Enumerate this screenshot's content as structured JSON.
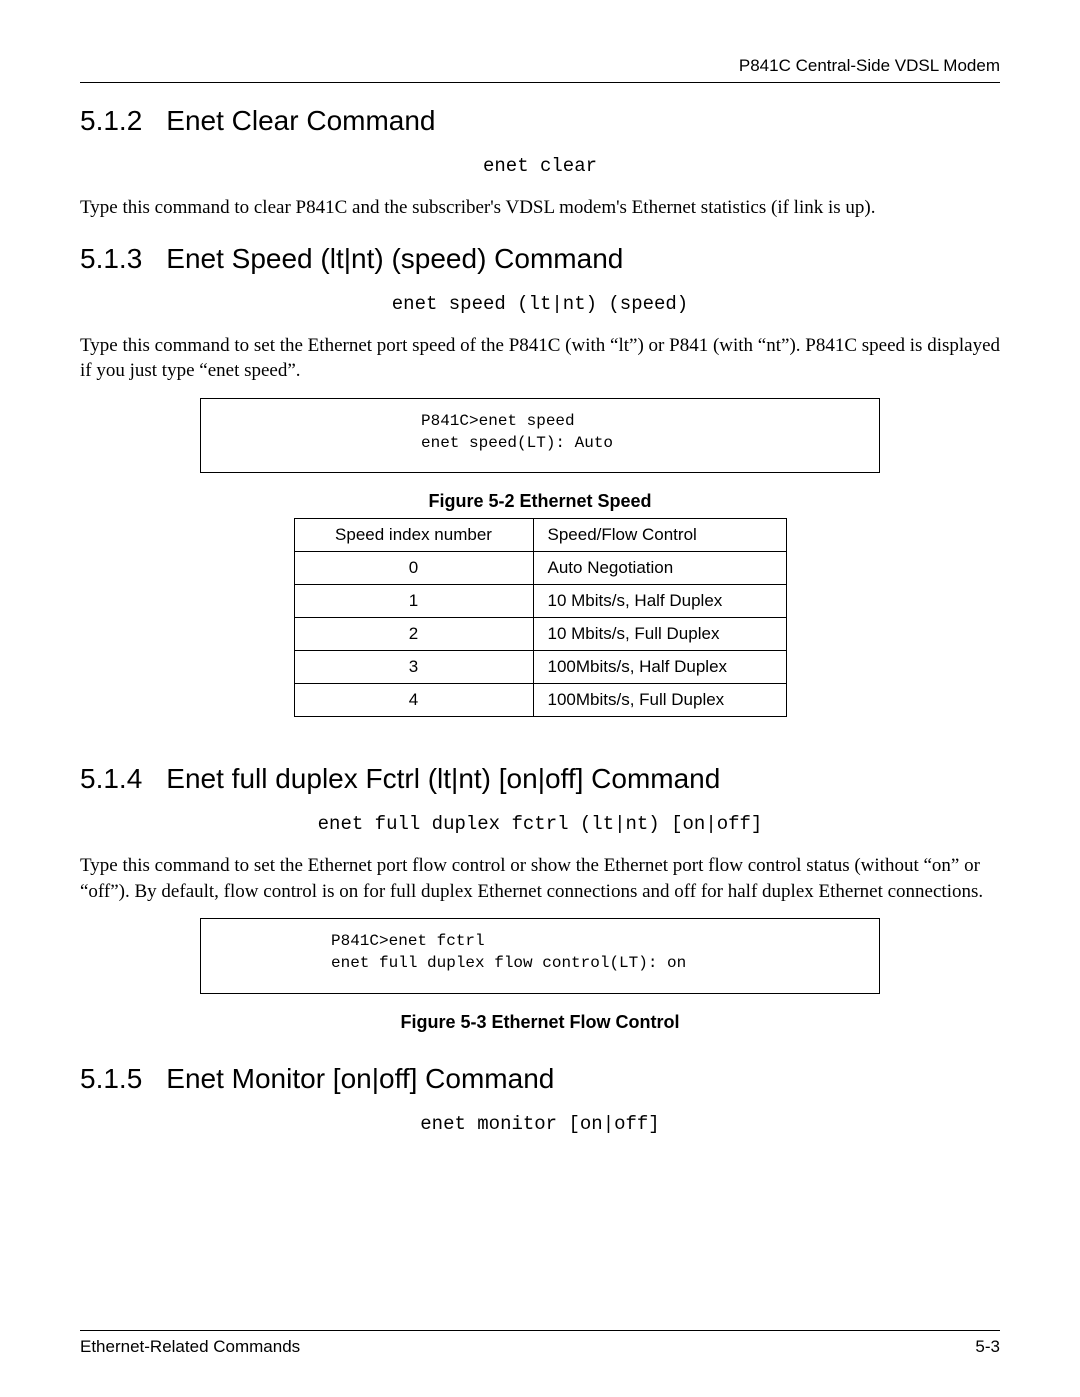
{
  "header": {
    "title": "P841C Central-Side VDSL Modem"
  },
  "sections": {
    "s512": {
      "number": "5.1.2",
      "title": "Enet Clear Command",
      "command": "enet clear",
      "paragraph": "Type this command to clear P841C and the subscriber's VDSL modem's Ethernet statistics (if link is up)."
    },
    "s513": {
      "number": "5.1.3",
      "title": "Enet Speed (lt|nt) (speed) Command",
      "command": "enet speed (lt|nt) (speed)",
      "paragraph": "Type this command to set the Ethernet port speed of the P841C (with “lt”) or P841 (with “nt”). P841C speed is displayed if you just type “enet speed”.",
      "code": "P841C>enet speed\nenet speed(LT): Auto",
      "figure_caption": "Figure 5-2 Ethernet Speed",
      "table": {
        "headers": [
          "Speed index number",
          "Speed/Flow Control"
        ],
        "rows": [
          [
            "0",
            "Auto Negotiation"
          ],
          [
            "1",
            "10 Mbits/s, Half Duplex"
          ],
          [
            "2",
            "10 Mbits/s, Full Duplex"
          ],
          [
            "3",
            "100Mbits/s, Half Duplex"
          ],
          [
            "4",
            "100Mbits/s, Full Duplex"
          ]
        ]
      }
    },
    "s514": {
      "number": "5.1.4",
      "title": "Enet full duplex Fctrl (lt|nt) [on|off] Command",
      "command": "enet full duplex fctrl (lt|nt) [on|off]",
      "paragraph": "Type this command to set the Ethernet port flow control or show the Ethernet port flow control status (without “on” or “off”). By default, flow control is on for full duplex Ethernet connections and off for half duplex Ethernet connections.",
      "code": "P841C>enet fctrl\nenet full duplex flow control(LT): on",
      "figure_caption": "Figure 5-3 Ethernet Flow Control"
    },
    "s515": {
      "number": "5.1.5",
      "title": "Enet Monitor [on|off] Command",
      "command": "enet monitor [on|off]"
    }
  },
  "footer": {
    "left": "Ethernet-Related Commands",
    "right": "5-3"
  }
}
